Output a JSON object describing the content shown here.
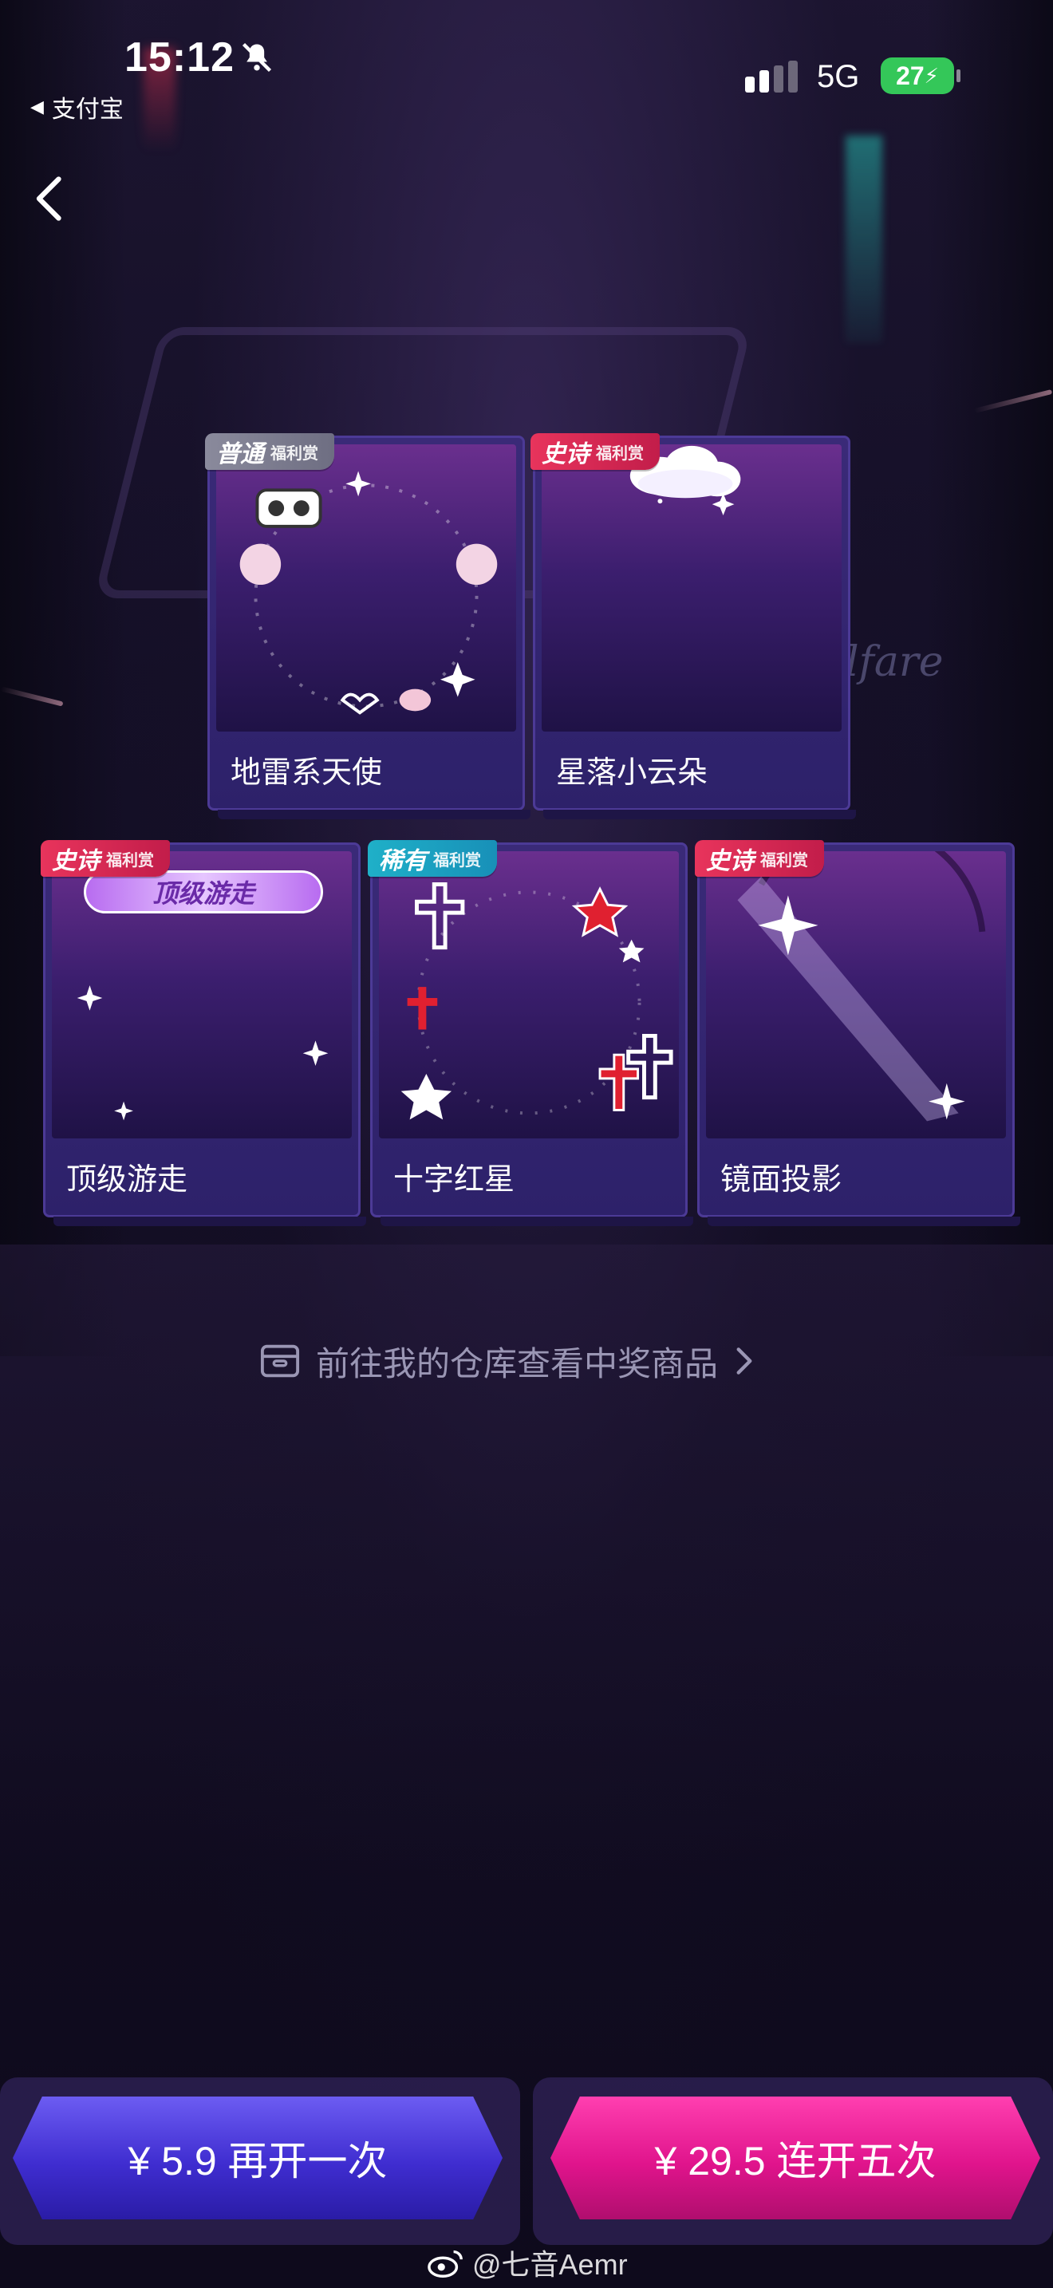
{
  "status_bar": {
    "time": "15:12",
    "back_to_app": "支付宝",
    "network": "5G",
    "battery": "27"
  },
  "cards": [
    {
      "name": "地雷系天使",
      "badge": "普通",
      "badge_sub": "福利赏",
      "tier": "common"
    },
    {
      "name": "星落小云朵",
      "badge": "史诗",
      "badge_sub": "福利赏",
      "tier": "epic"
    },
    {
      "name": "顶级游走",
      "badge": "史诗",
      "badge_sub": "福利赏",
      "tier": "epic",
      "thumb_text": "顶级游走"
    },
    {
      "name": "十字红星",
      "badge": "稀有",
      "badge_sub": "福利赏",
      "tier": "rare"
    },
    {
      "name": "镜面投影",
      "badge": "史诗",
      "badge_sub": "福利赏",
      "tier": "epic"
    }
  ],
  "warehouse_link": "前往我的仓库查看中奖商品",
  "buttons": {
    "once": "¥ 5.9 再开一次",
    "five": "¥ 29.5 连开五次"
  },
  "backdrop_text": "lfare",
  "watermark": "@七音Aemr",
  "colors": {
    "common": "#8a8a9c",
    "epic": "#e8345c",
    "rare": "#1fb0c8",
    "once_button": "#4a38dc",
    "five_button": "#e0148c",
    "battery": "#34c759"
  }
}
